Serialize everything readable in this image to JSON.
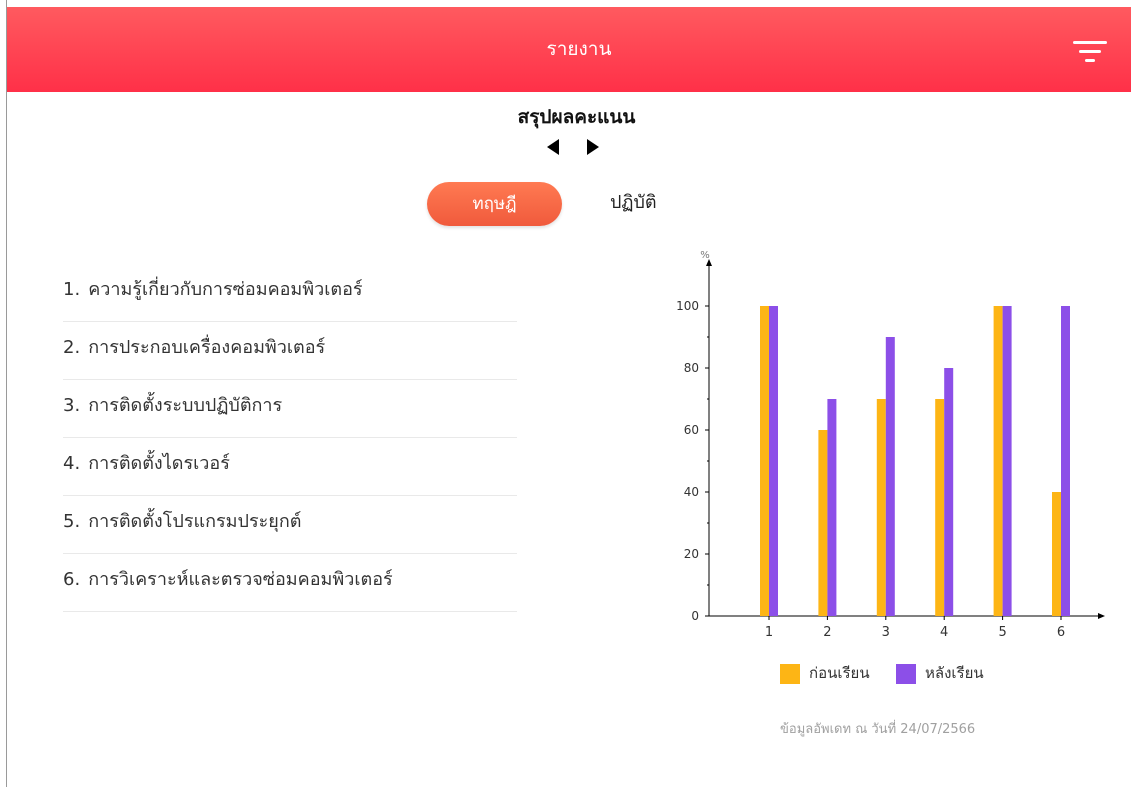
{
  "topbar": {
    "title": "รายงาน",
    "filter_icon": "filter-icon",
    "gradient_colors": [
      "#ff5a5f",
      "#ff3048"
    ]
  },
  "summary": {
    "title": "สรุปผลคะแนน",
    "prev_icon": "caret-left-icon",
    "next_icon": "caret-right-icon"
  },
  "tabs": [
    {
      "label": "ทฤษฎี",
      "selected": true
    },
    {
      "label": "ปฏิบัติ",
      "selected": false
    }
  ],
  "topics": [
    {
      "num": "1.",
      "label": "ความรู้เกี่ยวกับการซ่อมคอมพิวเตอร์"
    },
    {
      "num": "2.",
      "label": "การประกอบเครื่องคอมพิวเตอร์"
    },
    {
      "num": "3.",
      "label": "การติดตั้งระบบปฏิบัติการ"
    },
    {
      "num": "4.",
      "label": "การติดตั้งไดรเวอร์"
    },
    {
      "num": "5.",
      "label": "การติดตั้งโปรแกรมประยุกต์"
    },
    {
      "num": "6.",
      "label": "การวิเคราะห์และตรวจซ่อมคอมพิวเตอร์"
    }
  ],
  "chart_data": {
    "type": "bar",
    "ylabel": "%",
    "xlabel": "",
    "categories": [
      "1",
      "2",
      "3",
      "4",
      "5",
      "6"
    ],
    "ylim": [
      0,
      100
    ],
    "yticks": [
      0,
      20,
      40,
      60,
      80,
      100
    ],
    "series": [
      {
        "name": "ก่อนเรียน",
        "color": "#fdb515",
        "values": [
          100,
          60,
          70,
          70,
          100,
          40
        ]
      },
      {
        "name": "หลังเรียน",
        "color": "#8c4fe8",
        "values": [
          100,
          70,
          90,
          80,
          100,
          100
        ]
      }
    ],
    "grid": false,
    "legend_position": "bottom"
  },
  "update_note": "ข้อมูลอัพเดท ณ วันที่ 24/07/2566"
}
